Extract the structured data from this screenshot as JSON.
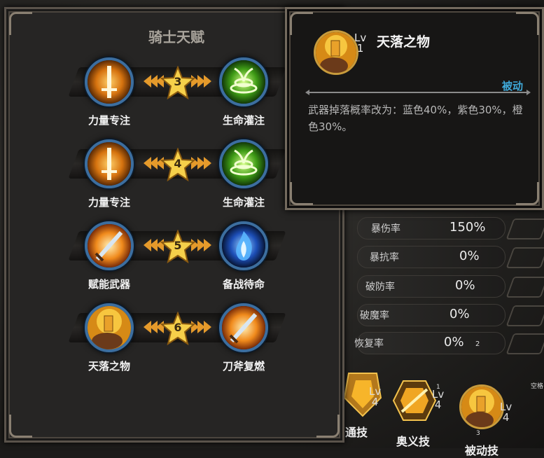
{
  "panel": {
    "title": "骑士天赋"
  },
  "talent_rows": [
    {
      "left": {
        "name": "力量专注",
        "icon": "sword-glow-icon"
      },
      "level": "3",
      "right": {
        "name": "生命灌注",
        "icon": "green-vine-icon"
      }
    },
    {
      "left": {
        "name": "力量专注",
        "icon": "sword-glow-icon"
      },
      "level": "4",
      "right": {
        "name": "生命灌注",
        "icon": "green-vine-icon"
      }
    },
    {
      "left": {
        "name": "赋能武器",
        "icon": "enchanted-sword-icon"
      },
      "level": "5",
      "right": {
        "name": "备战待命",
        "icon": "blue-flame-icon"
      }
    },
    {
      "left": {
        "name": "天落之物",
        "icon": "golden-treasure-icon"
      },
      "level": "6",
      "right": {
        "name": "刀斧复燃",
        "icon": "enchanted-sword-icon"
      }
    }
  ],
  "tooltip": {
    "name": "天落之物",
    "lv_label": "Lv",
    "lv_value": "1",
    "type": "被动",
    "description": "武器掉落概率改为：蓝色40%，紫色30%，橙色30%。"
  },
  "stats": [
    {
      "name": "暴伤率",
      "value": "150%"
    },
    {
      "name": "暴抗率",
      "value": "0%"
    },
    {
      "name": "破防率",
      "value": "0%"
    },
    {
      "name": "破魔率",
      "value": "0%"
    },
    {
      "name": "恢复率",
      "value": "0%"
    }
  ],
  "stats_small_number": "2",
  "bottom_skills": [
    {
      "name": "通技",
      "lv_label": "Lv",
      "lv_value": "4"
    },
    {
      "name": "奥义技",
      "lv_label": "Lv",
      "lv_value": "4",
      "badge": "1"
    },
    {
      "name": "被动技",
      "lv_label": "Lv",
      "lv_value": "4",
      "badge": "3"
    }
  ],
  "corner_hint": "空格",
  "colors": {
    "accent_gold": "#e59a2b",
    "passive_blue": "#3fa9d9",
    "ring_blue": "#3c6e9f"
  }
}
